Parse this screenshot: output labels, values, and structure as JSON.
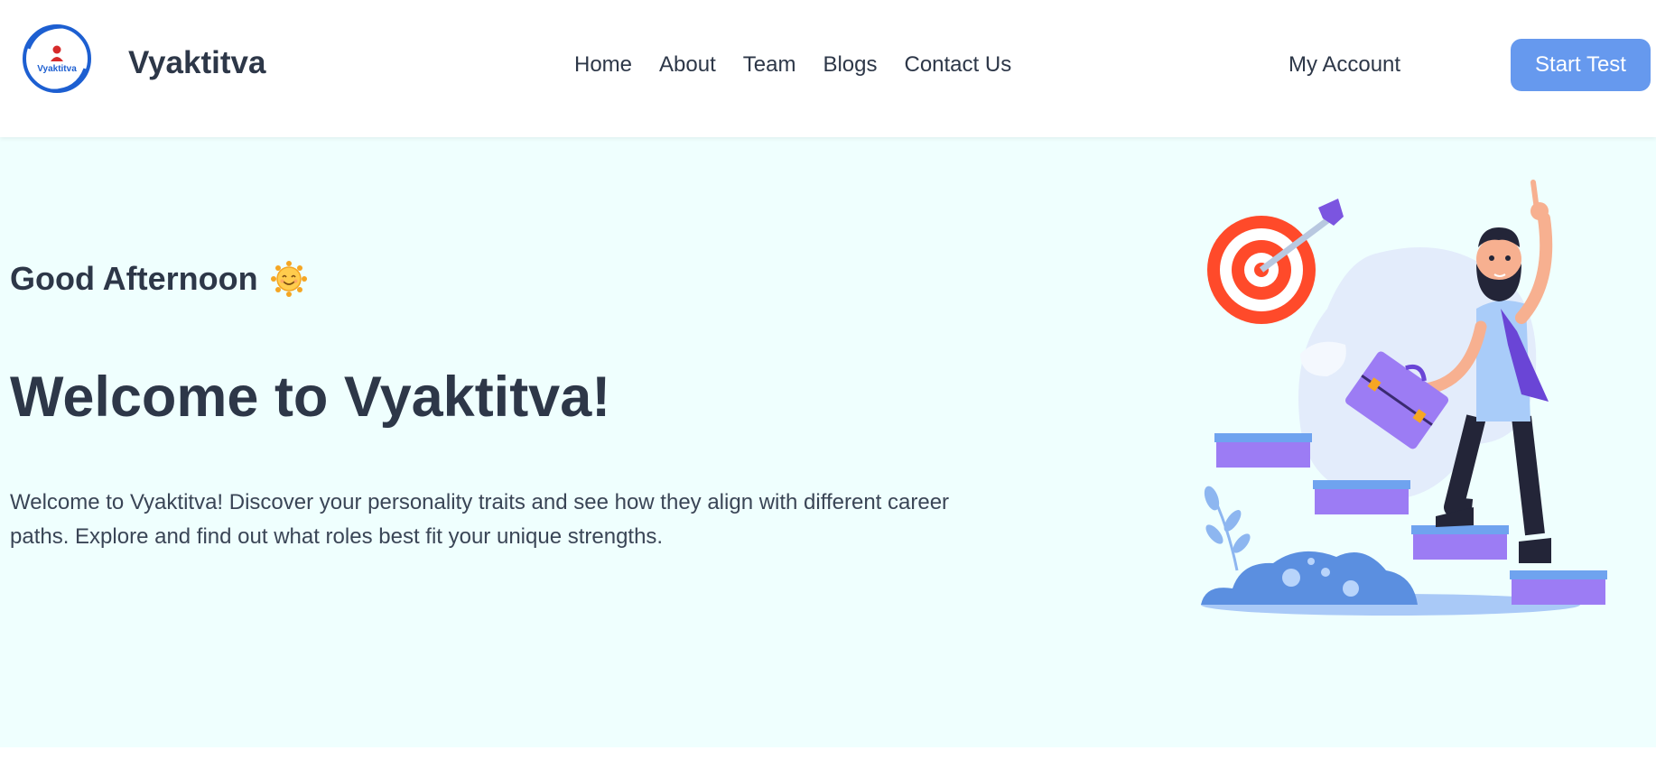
{
  "brand": {
    "logo_text": "Vyaktitva",
    "name": "Vyaktitva"
  },
  "nav": {
    "items": [
      "Home",
      "About",
      "Team",
      "Blogs",
      "Contact Us"
    ]
  },
  "account": {
    "label": "My Account"
  },
  "cta": {
    "label": "Start Test"
  },
  "hero": {
    "greeting": "Good Afternoon",
    "greeting_icon": "smiling-sun-icon",
    "title": "Welcome to Vyaktitva!",
    "description": "Welcome to Vyaktitva! Discover your personality traits and see how they align with different career paths. Explore and find out what roles best fit your unique strengths."
  },
  "colors": {
    "accent": "#6699ee",
    "hero_bg": "#effffe",
    "text": "#2d3748",
    "logo_ring": "#1d5fd1",
    "logo_person": "#d62b2b"
  }
}
